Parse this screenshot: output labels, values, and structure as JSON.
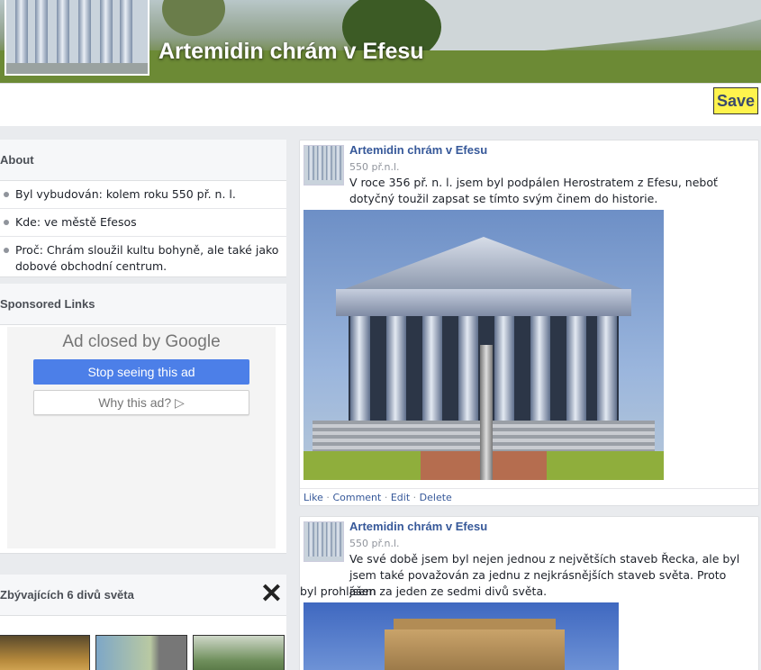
{
  "page": {
    "title": "Artemidin chrám v Efesu",
    "save_label": "Save"
  },
  "about": {
    "header": "About",
    "items": [
      "Byl vybudován: kolem roku 550 př. n. l.",
      "Kde: ve městě Efesos",
      "Proč: Chrám sloužil kultu bohyně, ale také jako dobové obchodní centrum."
    ]
  },
  "sponsored": {
    "header": "Sponsored Links",
    "ad_closed_prefix": "Ad closed by ",
    "ad_closed_brand": "Google",
    "stop_label": "Stop seeing this ad",
    "why_label": "Why this ad? ▷"
  },
  "wonders": {
    "header": "Zbývajících 6 divů světa",
    "close_glyph": "✕",
    "thumbnails": [
      "pyramids-image",
      "colossus-image",
      "hanging-gardens-image"
    ]
  },
  "posts": [
    {
      "author": "Artemidin chrám v Efesu",
      "date": "550 př.n.l.",
      "text": "V roce 356 př. n. l. jsem byl podpálen Herostratem z Efesu, neboť dotyčný toužil zapsat se tímto svým činem do historie.",
      "actions": [
        "Like",
        "Comment",
        "Edit",
        "Delete"
      ]
    },
    {
      "author": "Artemidin chrám v Efesu",
      "date": "550 př.n.l.",
      "text_first": "Ve své době jsem byl nejen jednou z největších staveb Řecka, ale byl jsem také považován za jednu z nejkrásnějších staveb světa. Proto jsem",
      "text_rest": "byl prohlášen za jeden ze sedmi divů světa."
    }
  ],
  "colors": {
    "link": "#365899",
    "save_bg": "#fff34d",
    "ad_button": "#4c7fe8"
  }
}
